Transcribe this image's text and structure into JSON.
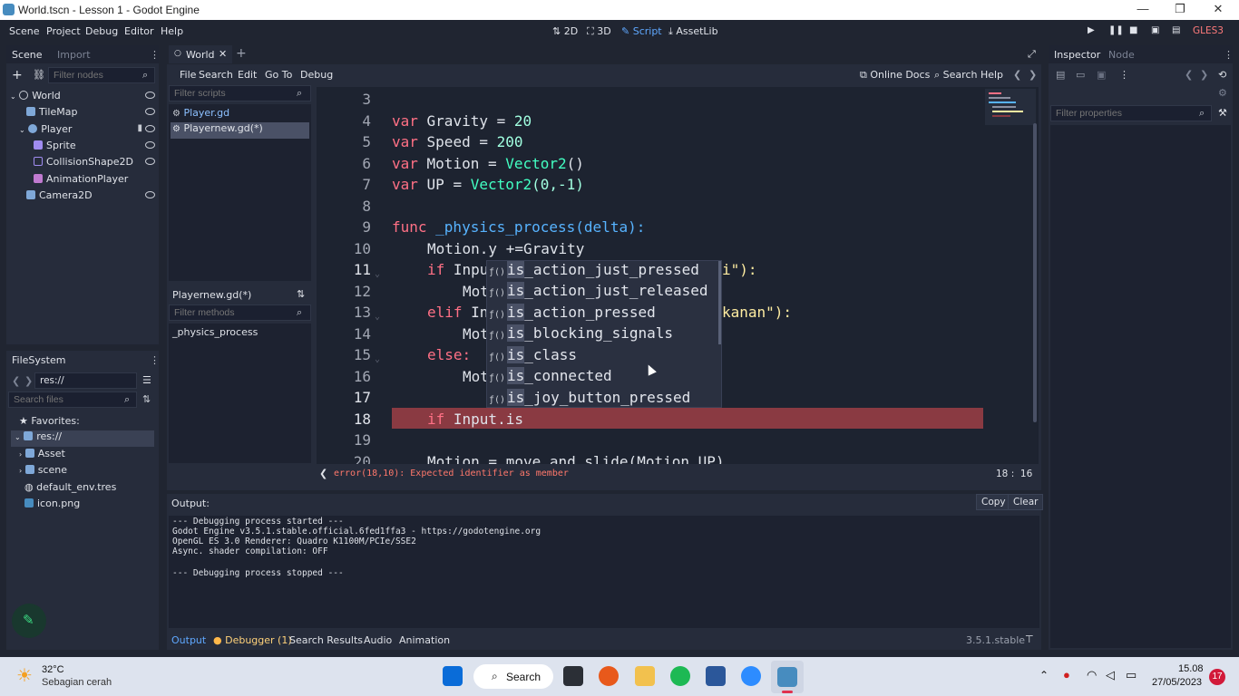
{
  "window": {
    "title": "World.tscn - Lesson 1 - Godot Engine"
  },
  "menubar": {
    "items": [
      "Scene",
      "Project",
      "Debug",
      "Editor",
      "Help"
    ],
    "workspaces": [
      "2D",
      "3D",
      "Script",
      "AssetLib"
    ],
    "renderer": "GLES3"
  },
  "scene_dock": {
    "tabs": [
      "Scene",
      "Import"
    ],
    "filter_placeholder": "Filter nodes",
    "nodes": [
      "World",
      "TileMap",
      "Player",
      "Sprite",
      "CollisionShape2D",
      "AnimationPlayer",
      "Camera2D"
    ]
  },
  "filesystem_dock": {
    "title": "FileSystem",
    "path": "res://",
    "search_placeholder": "Search files",
    "items": [
      "Favorites:",
      "res://",
      "Asset",
      "scene",
      "default_env.tres",
      "icon.png"
    ]
  },
  "editor_tabs": {
    "current": "World"
  },
  "script_menu": [
    "File",
    "Search",
    "Edit",
    "Go To",
    "Debug"
  ],
  "script_toolbar": {
    "online_docs": "Online Docs",
    "search_help": "Search Help"
  },
  "scripts_panel": {
    "filter_placeholder": "Filter scripts",
    "scripts": [
      "Player.gd",
      "Playernew.gd(*)"
    ],
    "current_script": "Playernew.gd(*)",
    "filter_methods_placeholder": "Filter methods",
    "methods": [
      "_physics_process"
    ]
  },
  "code": {
    "line_numbers": [
      "3",
      "4",
      "5",
      "6",
      "7",
      "8",
      "9",
      "10",
      "11",
      "12",
      "13",
      "14",
      "15",
      "16",
      "17",
      "18",
      "19",
      "20"
    ],
    "lines": {
      "l4": {
        "kw": "var",
        "rest": " Gravity = ",
        "val": "20"
      },
      "l5": {
        "kw": "var",
        "rest": " Speed = ",
        "val": "200"
      },
      "l6": {
        "kw": "var",
        "rest": " Motion = ",
        "ty": "Vector2",
        "tail": "()"
      },
      "l7": {
        "kw": "var",
        "rest": " UP = ",
        "ty": "Vector2",
        "tail": "(0,-1)"
      },
      "l9": {
        "kw": "func",
        "rest": " _physics_process(delta):"
      },
      "l10": "Motion.y +=Gravity",
      "l11a": "if",
      "l11b": " Inpu",
      "l11c": "i\"):",
      "l12": "Mot",
      "l13a": "elif",
      "l13b": " In",
      "l13c": "kanan\"):",
      "l14": "Mot",
      "l15": "else:",
      "l16": "Mot",
      "l18a": "if",
      "l18b": " Input.is",
      "l20": "Motion = move_and_slide(Motion,UP)"
    },
    "error": "error(18,10): Expected identifier as member",
    "cursor": "18 :  16"
  },
  "autocomplete": {
    "typed_prefix": "is",
    "items": [
      "is_action_just_pressed",
      "is_action_just_released",
      "is_action_pressed",
      "is_blocking_signals",
      "is_class",
      "is_connected",
      "is_joy_button_pressed"
    ]
  },
  "output": {
    "label": "Output:",
    "copy": "Copy",
    "clear": "Clear",
    "lines": [
      "--- Debugging process started ---",
      "Godot Engine v3.5.1.stable.official.6fed1ffa3 - https://godotengine.org",
      "OpenGL ES 3.0 Renderer: Quadro K1100M/PCIe/SSE2",
      "Async. shader compilation: OFF",
      "",
      "--- Debugging process stopped ---"
    ]
  },
  "bottom_tabs": [
    "Output",
    "Debugger (1)",
    "Search Results",
    "Audio",
    "Animation"
  ],
  "version": "3.5.1.stable",
  "inspector": {
    "tabs": [
      "Inspector",
      "Node"
    ],
    "filter_placeholder": "Filter properties"
  },
  "taskbar": {
    "weather_temp": "32°C",
    "weather_desc": "Sebagian cerah",
    "search": "Search",
    "time": "15.08",
    "date": "27/05/2023",
    "badge": "17"
  },
  "colors": {
    "accent": "#5fa8ff",
    "error": "#ff786b",
    "error_line": "#8a3a42"
  }
}
